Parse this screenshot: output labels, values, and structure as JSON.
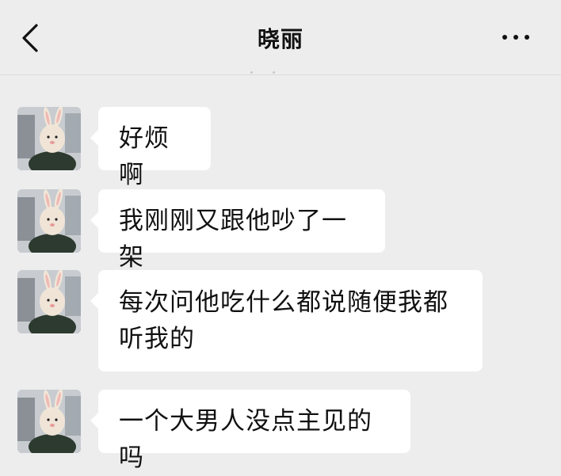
{
  "header": {
    "title": "晓丽",
    "back_icon": "chevron-left-icon",
    "more_icon": "ellipsis-icon"
  },
  "messages": [
    {
      "sender": "晓丽",
      "text": "好烦啊"
    },
    {
      "sender": "晓丽",
      "text": "我刚刚又跟他吵了一架"
    },
    {
      "sender": "晓丽",
      "text": "每次问他吃什么都说随便我都听我的"
    },
    {
      "sender": "晓丽",
      "text": "一个大男人没点主见的吗"
    }
  ]
}
